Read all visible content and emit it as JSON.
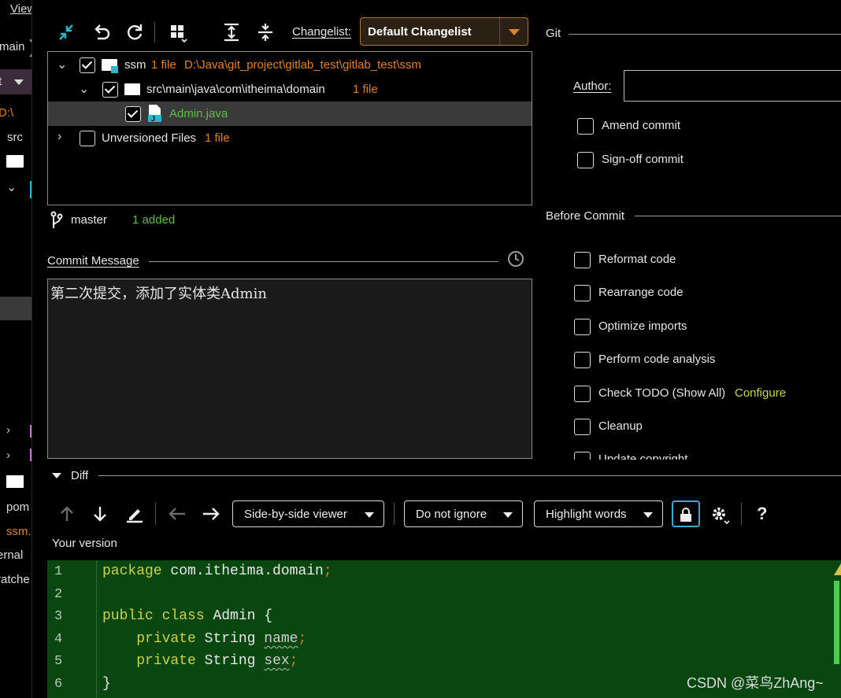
{
  "left_strip": {
    "items": [
      "View",
      "main",
      "t",
      "D:\\",
      "src",
      "pom",
      "ssm.",
      "ernal",
      "ratche"
    ]
  },
  "toolbar": {
    "changelist_label": "Changelist:",
    "changelist_value": "Default Changelist"
  },
  "tree": {
    "root": {
      "name": "ssm",
      "count": "1 file",
      "path": "D:\\Java\\git_project\\gitlab_test\\gitlab_test\\ssm"
    },
    "package": {
      "name": "src\\main\\java\\com\\itheima\\domain",
      "count": "1 file"
    },
    "file": {
      "name": "Admin.java"
    },
    "unversioned": {
      "name": "Unversioned Files",
      "count": "1 file"
    }
  },
  "branch": {
    "name": "master",
    "status": "1 added"
  },
  "commit_message": {
    "label": "Commit Message",
    "value": "第二次提交，添加了实体类Admin"
  },
  "git_panel": {
    "title": "Git",
    "author_label": "Author:",
    "amend": "Amend commit",
    "signoff": "Sign-off commit"
  },
  "before_commit": {
    "title": "Before Commit",
    "options": [
      "Reformat code",
      "Rearrange code",
      "Optimize imports",
      "Perform code analysis",
      "Check TODO (Show All)",
      "Cleanup",
      "Update copyright"
    ],
    "configure_link": "Configure"
  },
  "diff": {
    "title": "Diff",
    "viewer": "Side-by-side viewer",
    "ignore": "Do not ignore",
    "highlight": "Highlight words",
    "help": "?",
    "your_version": "Your version"
  },
  "code_lines": {
    "n1": "1",
    "n2": "2",
    "n3": "3",
    "n4": "4",
    "n5": "5",
    "n6": "6",
    "l1_kw": "package",
    "l1_rest": " com.itheima.domain",
    "l3_kw1": "public",
    "l3_kw2": "class",
    "l3_rest": " Admin {",
    "l4_kw": "private",
    "l4_type": " String ",
    "l4_var": "name",
    "l5_kw": "private",
    "l5_type": " String ",
    "l5_var": "sex",
    "l6": "}",
    "semicolon": ";"
  },
  "watermark": "CSDN @菜鸟ZhAng~",
  "colors": {
    "accent_orange": "#e0822b",
    "added_green": "#5fbf4a",
    "code_bg": "#0a4710",
    "keyword": "#cfcf4a",
    "configure_link": "#c8d94a"
  }
}
